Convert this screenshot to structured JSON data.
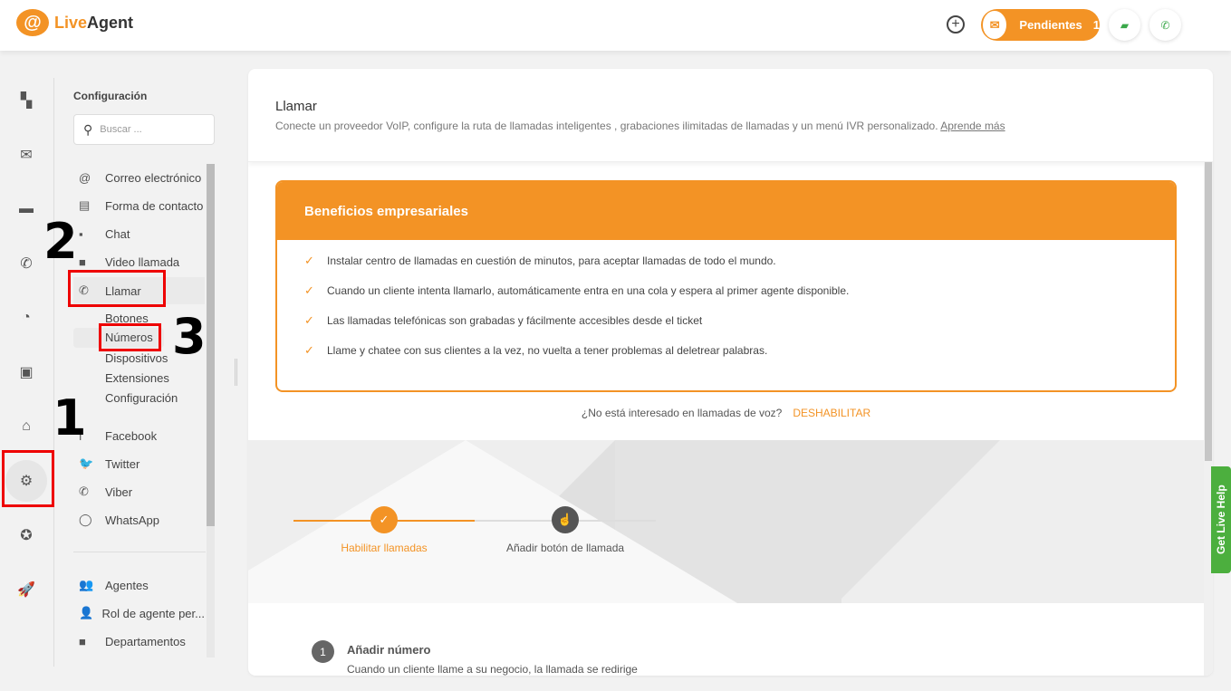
{
  "header": {
    "logo_live": "Live",
    "logo_agent": "Agent",
    "pending_label": "Pendientes",
    "pending_count": "1"
  },
  "rail": {
    "items": [
      "dashboard-icon",
      "mail-icon",
      "chat-icon",
      "phone-icon",
      "reports-icon",
      "contacts-icon",
      "bank-icon",
      "gear-icon",
      "star-icon",
      "rocket-icon"
    ]
  },
  "nav": {
    "title": "Configuración",
    "search_placeholder": "Buscar ...",
    "items": [
      {
        "label": "Correo electrónico",
        "icon": "@"
      },
      {
        "label": "Forma de contacto",
        "icon": "▤"
      },
      {
        "label": "Chat",
        "icon": "▪"
      },
      {
        "label": "Video llamada",
        "icon": "■"
      },
      {
        "label": "Llamar",
        "icon": "✆"
      }
    ],
    "sub_items": [
      "Botones",
      "Números",
      "Dispositivos",
      "Extensiones",
      "Configuración"
    ],
    "social": [
      {
        "label": "Facebook",
        "icon": "f"
      },
      {
        "label": "Twitter",
        "icon": "🐦"
      },
      {
        "label": "Viber",
        "icon": "✆"
      },
      {
        "label": "WhatsApp",
        "icon": "◯"
      }
    ],
    "others": [
      {
        "label": "Agentes",
        "icon": "👥"
      },
      {
        "label": "Rol de agente per...",
        "icon": "👤"
      },
      {
        "label": "Departamentos",
        "icon": "■"
      }
    ]
  },
  "main": {
    "title": "Llamar",
    "description": "Conecte un proveedor VoIP, configure la ruta de llamadas inteligentes , grabaciones ilimitadas de llamadas y un menú IVR personalizado.",
    "learn_more": "Aprende más",
    "benefits_title": "Beneficios empresariales",
    "benefits": [
      "Instalar centro de llamadas en cuestión de minutos, para aceptar llamadas de todo el mundo.",
      "Cuando un cliente intenta llamarlo, automáticamente entra en una cola y espera al primer agente disponible.",
      "Las llamadas telefónicas son grabadas y fácilmente accesibles desde el ticket",
      "Llame y chatee con sus clientes a la vez, no vuelta a tener problemas al deletrear palabras."
    ],
    "disable_question": "¿No está interesado en llamadas de voz?",
    "disable_link": "DESHABILITAR",
    "steps": [
      {
        "label": "Habilitar llamadas",
        "done": true
      },
      {
        "label": "Añadir botón de llamada",
        "done": false
      }
    ],
    "step1_number": "1",
    "step1_title": "Añadir número",
    "step1_desc": "Cuando un cliente llame a su negocio, la llamada se redirige"
  },
  "help_tab": "Get Live Help",
  "annotations": [
    "1",
    "2",
    "3"
  ],
  "colors": {
    "accent": "#f39325",
    "green": "#4caf3e",
    "annotation": "#e00000"
  }
}
